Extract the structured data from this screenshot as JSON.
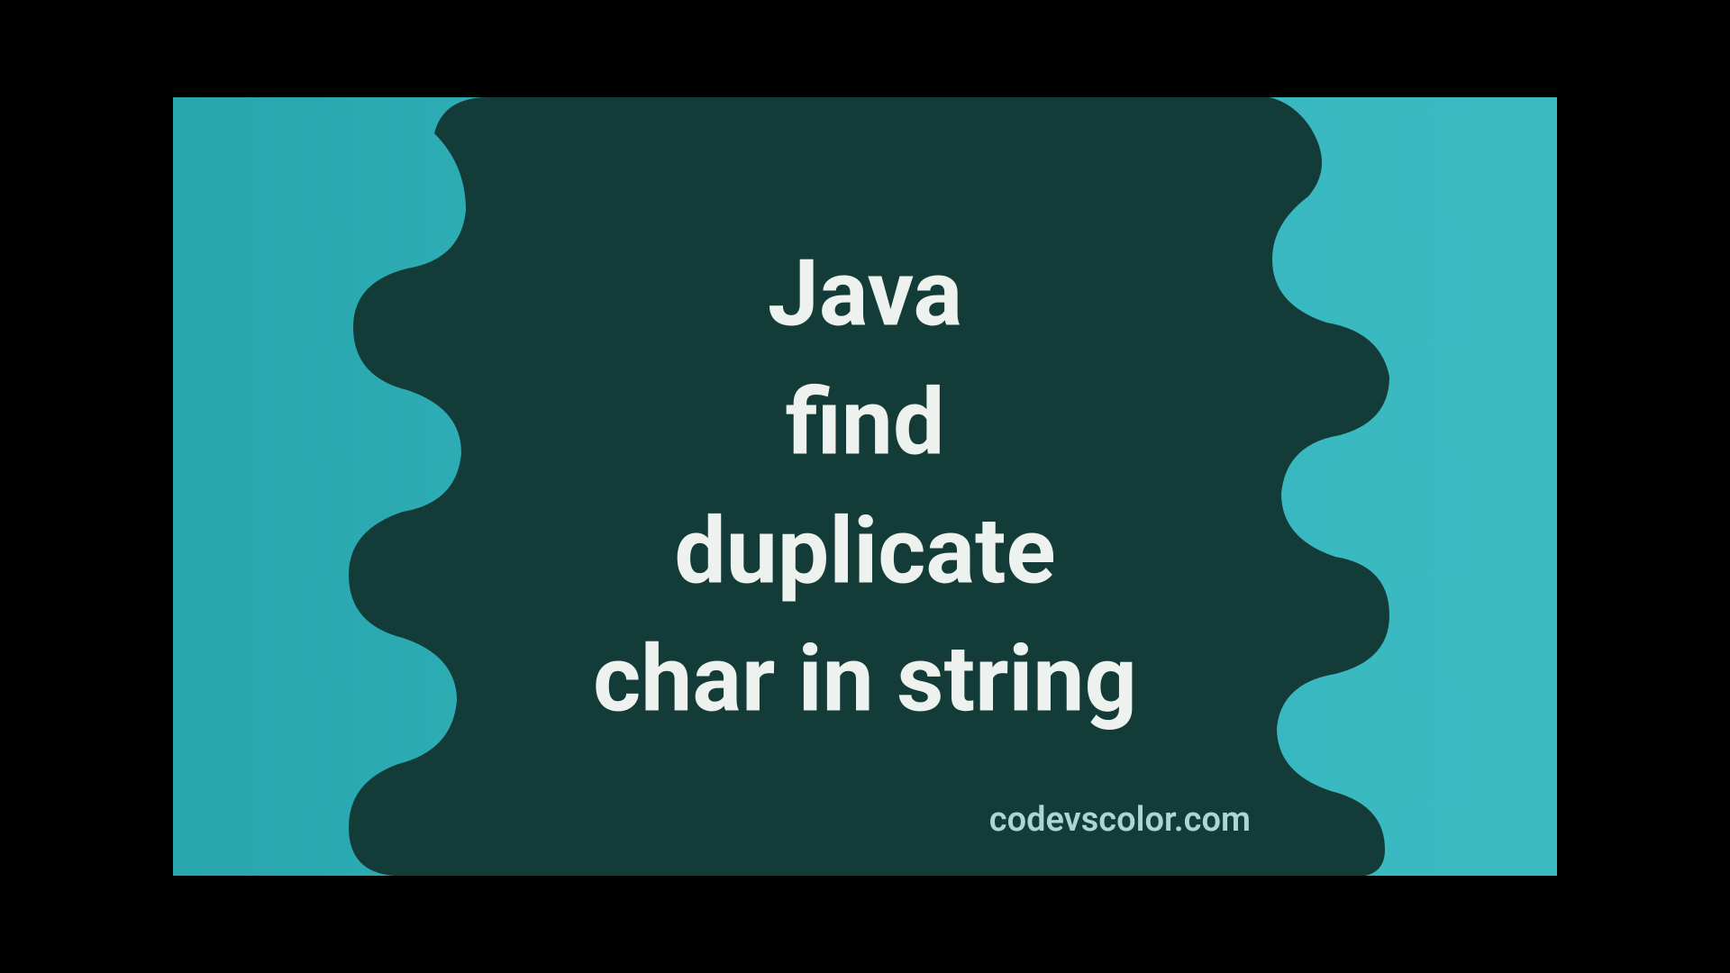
{
  "title": {
    "line1": "Java",
    "line2": "find",
    "line3": "duplicate",
    "line4": "char in string"
  },
  "watermark": "codevscolor.com",
  "colors": {
    "background_gradient_start": "#28a5ad",
    "background_gradient_end": "#3cbac2",
    "blob": "#133b38",
    "text": "#edf2ef",
    "watermark": "#a9d7d5"
  }
}
